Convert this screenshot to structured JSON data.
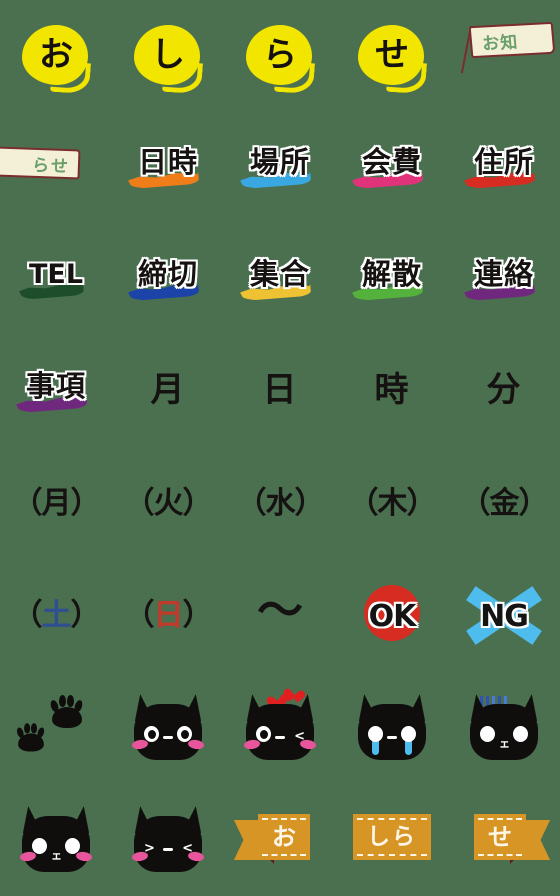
{
  "sheet": {
    "title": "Emoji sticker sheet",
    "background_color": "#4a7050",
    "columns": 5,
    "rows": 8
  },
  "palette": {
    "background": "#4a7050",
    "bubble_yellow": "#f2e500",
    "flag_cloth": "#f4f0d8",
    "flag_border": "#7a2d2d",
    "flag_text": "#6a9e6a",
    "ink_black": "#151211",
    "ribbon_orange": "#d79526",
    "ribbon_fold": "#6a1a14",
    "ribbon_text": "#fdf5e6",
    "cat_black": "#100e0d",
    "cheek_pink": "#e8559c",
    "tear_blue": "#4fbcee",
    "heart_red": "#e02020",
    "ok_red": "#d62c22",
    "ng_blue": "#4fbcee",
    "saturday_blue": "#2f4f91",
    "sunday_red": "#c0392b"
  },
  "stickers": [
    {
      "id": "bubble-o",
      "kind": "blob",
      "text": "お"
    },
    {
      "id": "bubble-shi",
      "kind": "blob",
      "text": "し"
    },
    {
      "id": "bubble-ra",
      "kind": "blob",
      "text": "ら"
    },
    {
      "id": "bubble-se",
      "kind": "blob",
      "text": "せ"
    },
    {
      "id": "flag-oshira",
      "kind": "flag-right",
      "text": "お知"
    },
    {
      "id": "flag-rase",
      "kind": "flag-left",
      "text": "らせ"
    },
    {
      "id": "word-nichiji",
      "kind": "word",
      "text": "日時",
      "underline": "#ef7d1a"
    },
    {
      "id": "word-basho",
      "kind": "word",
      "text": "場所",
      "underline": "#3aa8e0"
    },
    {
      "id": "word-kaihi",
      "kind": "word",
      "text": "会費",
      "underline": "#e0337a"
    },
    {
      "id": "word-jusho",
      "kind": "word",
      "text": "住所",
      "underline": "#d62c22"
    },
    {
      "id": "word-tel",
      "kind": "word-latin",
      "text": "TEL",
      "underline": "#1d4d2b"
    },
    {
      "id": "word-shimekiri",
      "kind": "word",
      "text": "締切",
      "underline": "#1b43a8"
    },
    {
      "id": "word-shugo",
      "kind": "word",
      "text": "集合",
      "underline": "#eec232"
    },
    {
      "id": "word-kaisan",
      "kind": "word",
      "text": "解散",
      "underline": "#54b23c"
    },
    {
      "id": "word-renraku",
      "kind": "word",
      "text": "連絡",
      "underline": "#70287f"
    },
    {
      "id": "word-jiko",
      "kind": "word",
      "text": "事項",
      "underline": "#70287f"
    },
    {
      "id": "word-getsu",
      "kind": "word-plain",
      "text": "月"
    },
    {
      "id": "word-nichi",
      "kind": "word-plain",
      "text": "日"
    },
    {
      "id": "word-ji",
      "kind": "word-plain",
      "text": "時"
    },
    {
      "id": "word-fun",
      "kind": "word-plain",
      "text": "分"
    },
    {
      "id": "day-mon",
      "kind": "paren",
      "text": "月",
      "full": "（月）"
    },
    {
      "id": "day-tue",
      "kind": "paren",
      "text": "火",
      "full": "（火）"
    },
    {
      "id": "day-wed",
      "kind": "paren",
      "text": "水",
      "full": "（水）"
    },
    {
      "id": "day-thu",
      "kind": "paren",
      "text": "木",
      "full": "（木）"
    },
    {
      "id": "day-fri",
      "kind": "paren",
      "text": "金",
      "full": "（金）"
    },
    {
      "id": "day-sat",
      "kind": "paren-sat",
      "text": "土",
      "full": "（土）"
    },
    {
      "id": "day-sun",
      "kind": "paren-sun",
      "text": "日",
      "full": "（日）"
    },
    {
      "id": "tilde",
      "kind": "tilde",
      "text": "〜"
    },
    {
      "id": "badge-ok",
      "kind": "badge-ok",
      "text": "OK"
    },
    {
      "id": "badge-ng",
      "kind": "badge-ng",
      "text": "NG"
    },
    {
      "id": "paw-prints",
      "kind": "paws",
      "text": ""
    },
    {
      "id": "cat-normal",
      "kind": "cat-normal",
      "text": ""
    },
    {
      "id": "cat-love",
      "kind": "cat-love",
      "text": ""
    },
    {
      "id": "cat-cry",
      "kind": "cat-cry",
      "text": ""
    },
    {
      "id": "cat-gloom",
      "kind": "cat-gloom",
      "text": ""
    },
    {
      "id": "cat-plain",
      "kind": "cat-plain",
      "text": ""
    },
    {
      "id": "cat-smile",
      "kind": "cat-smile",
      "text": ""
    },
    {
      "id": "ribbon-o",
      "kind": "ribbon-left",
      "text": "お"
    },
    {
      "id": "ribbon-shira",
      "kind": "ribbon-wide",
      "text": "しら"
    },
    {
      "id": "ribbon-se",
      "kind": "ribbon-right",
      "text": "せ"
    }
  ],
  "parens": {
    "open": "（",
    "close": "）"
  },
  "cat_faces": {
    "wink_right": "<",
    "wink_left": ">",
    "nose": "ェ",
    "mouth_dash": "-"
  }
}
